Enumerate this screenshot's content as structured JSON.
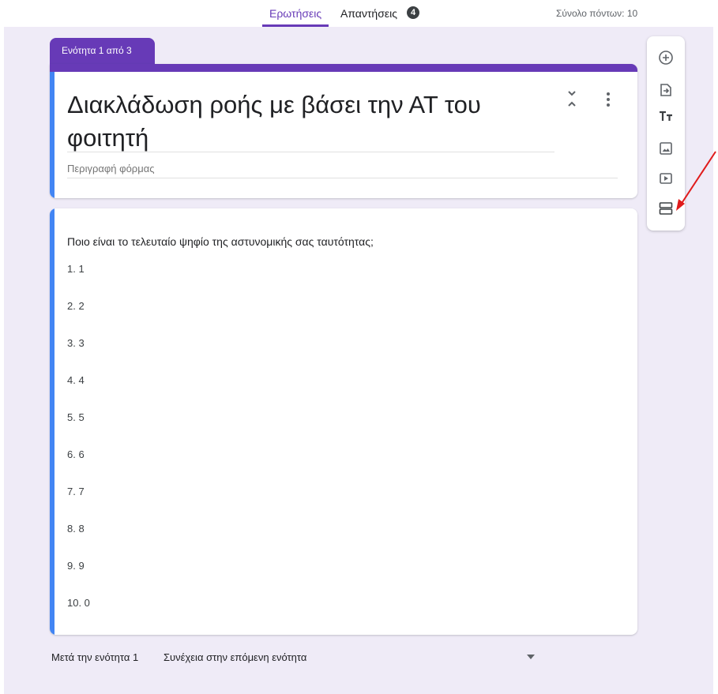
{
  "tabs": {
    "questions_label": "Ερωτήσεις",
    "responses_label": "Απαντήσεις",
    "responses_count": "4"
  },
  "total_points": "Σύνολο πόντων: 10",
  "section": {
    "tag": "Ενότητα 1 από 3",
    "title": "Διακλάδωση ροής με βάσει την ΑΤ του φοιτητή",
    "description_placeholder": "Περιγραφή φόρμας"
  },
  "question": {
    "text": "Ποιο είναι το τελευταίο ψηφίο της αστυνομικής σας ταυτότητας;",
    "options": [
      "1.  1",
      "2.  2",
      "3.  3",
      "4.  4",
      "5.  5",
      "6.  6",
      "7.  7",
      "8.  8",
      "9.  9",
      "10.  0"
    ]
  },
  "after_section": {
    "label": "Μετά την ενότητα 1",
    "value": "Συνέχεια στην επόμενη ενότητα"
  },
  "toolbar": {
    "items": [
      "add-question-icon",
      "import-questions-icon",
      "add-title-icon",
      "add-image-icon",
      "add-video-icon",
      "add-section-icon"
    ]
  },
  "colors": {
    "accent": "#673ab7",
    "left_bar": "#4285f4",
    "canvas": "#efebf7",
    "annotation_arrow": "#e01b1b"
  }
}
